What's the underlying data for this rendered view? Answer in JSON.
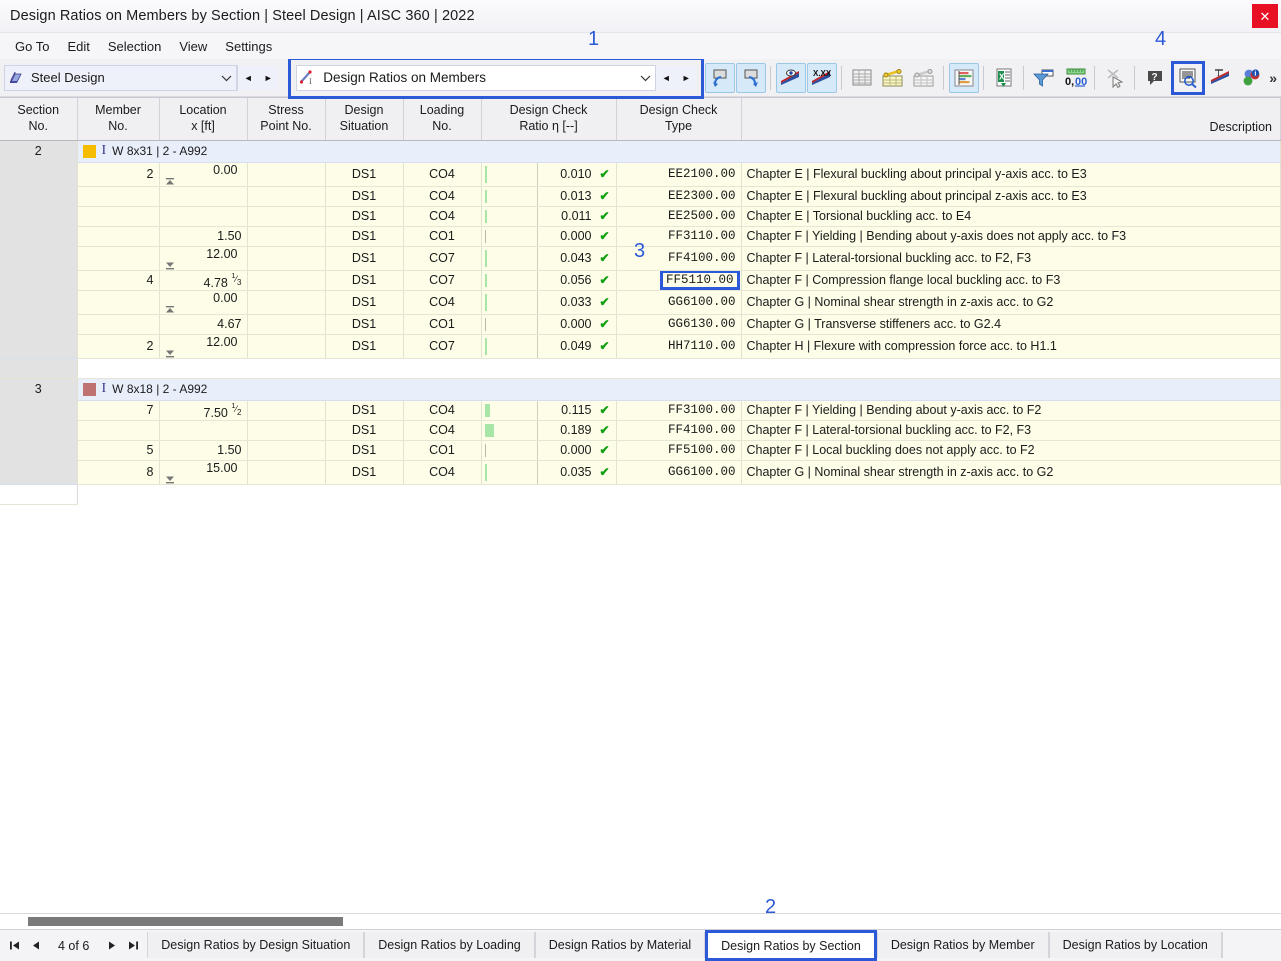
{
  "window": {
    "title": "Design Ratios on Members by Section | Steel Design | AISC 360 | 2022",
    "close_label": "✕"
  },
  "menu": {
    "items": [
      {
        "label": "Go To",
        "name": "menu-go-to"
      },
      {
        "label": "Edit",
        "name": "menu-edit"
      },
      {
        "label": "Selection",
        "name": "menu-selection"
      },
      {
        "label": "View",
        "name": "menu-view"
      },
      {
        "label": "Settings",
        "name": "menu-settings"
      }
    ]
  },
  "toolbar": {
    "module_combo": {
      "value": "Steel Design",
      "icon": "steel-beam-icon"
    },
    "table_combo": {
      "value": "Design Ratios on Members",
      "icon": "design-ratio-icon"
    },
    "caret": "⌵",
    "prev": "◄",
    "next": "►",
    "overflow": "»",
    "buttons": [
      {
        "name": "undo-view-button",
        "icon": "undo-screen-icon"
      },
      {
        "name": "redo-view-button",
        "icon": "redo-screen-icon"
      },
      {
        "name": "show-results-button",
        "icon": "eye-results-icon"
      },
      {
        "name": "show-values-button",
        "icon": "xxx-values-icon"
      },
      {
        "name": "table-all-button",
        "icon": "table-grey-icon"
      },
      {
        "name": "table-members-button",
        "icon": "table-member-icon"
      },
      {
        "name": "table-surfaces-button",
        "icon": "table-surface-icon"
      },
      {
        "name": "result-diagram-button",
        "icon": "bar-diagram-icon"
      },
      {
        "name": "export-excel-button",
        "icon": "excel-export-icon"
      },
      {
        "name": "filter-button",
        "icon": "funnel-icon"
      },
      {
        "name": "decimal-places-button",
        "icon": "decimals-0-00-icon"
      },
      {
        "name": "select-objects-button",
        "icon": "arrow-select-icon"
      },
      {
        "name": "help-button",
        "icon": "question-balloon-icon"
      },
      {
        "name": "table-report-button",
        "icon": "table-magnifier-icon"
      },
      {
        "name": "member-results-button",
        "icon": "member-diagram-icon"
      },
      {
        "name": "info-button",
        "icon": "color-info-icon"
      }
    ]
  },
  "callouts": [
    {
      "number": "1",
      "name": "callout-1"
    },
    {
      "number": "2",
      "name": "callout-2"
    },
    {
      "number": "3",
      "name": "callout-3"
    },
    {
      "number": "4",
      "name": "callout-4"
    }
  ],
  "table": {
    "columns": [
      {
        "label_1": "Section",
        "label_2": "No."
      },
      {
        "label_1": "Member",
        "label_2": "No."
      },
      {
        "label_1": "Location",
        "label_2": "x [ft]"
      },
      {
        "label_1": "Stress",
        "label_2": "Point No."
      },
      {
        "label_1": "Design",
        "label_2": "Situation"
      },
      {
        "label_1": "Loading",
        "label_2": "No."
      },
      {
        "label_1": "Design Check",
        "label_2": "Ratio η [--]"
      },
      {
        "label_1": "Design Check",
        "label_2": "Type"
      },
      {
        "label_1": "",
        "label_2": "Description"
      }
    ],
    "groups": [
      {
        "section_no": "2",
        "color": "#f5bc00",
        "title": "W 8x31 | 2 - A992",
        "rows": [
          {
            "member": "2",
            "location": "0.00",
            "loc_mark": "start",
            "stress_point": "",
            "design_situation": "DS1",
            "loading": "CO4",
            "ratio": "0.010",
            "bar_pct": 1.0,
            "check_type": "EE2100.00",
            "description": "Chapter E | Flexural buckling about principal y-axis acc. to E3",
            "highlight": false
          },
          {
            "member": "",
            "location": "",
            "loc_mark": "",
            "stress_point": "",
            "design_situation": "DS1",
            "loading": "CO4",
            "ratio": "0.013",
            "bar_pct": 1.3,
            "check_type": "EE2300.00",
            "description": "Chapter E | Flexural buckling about principal z-axis acc. to E3",
            "highlight": false
          },
          {
            "member": "",
            "location": "",
            "loc_mark": "",
            "stress_point": "",
            "design_situation": "DS1",
            "loading": "CO4",
            "ratio": "0.011",
            "bar_pct": 1.1,
            "check_type": "EE2500.00",
            "description": "Chapter E | Torsional buckling acc. to E4",
            "highlight": false
          },
          {
            "member": "",
            "location": "1.50",
            "loc_mark": "",
            "stress_point": "",
            "design_situation": "DS1",
            "loading": "CO1",
            "ratio": "0.000",
            "bar_pct": 0.0,
            "check_type": "FF3110.00",
            "description": "Chapter F | Yielding | Bending about y-axis does not apply acc. to F3",
            "highlight": false
          },
          {
            "member": "",
            "location": "12.00",
            "loc_mark": "end",
            "stress_point": "",
            "design_situation": "DS1",
            "loading": "CO7",
            "ratio": "0.043",
            "bar_pct": 4.3,
            "check_type": "FF4100.00",
            "description": "Chapter F | Lateral-torsional buckling acc. to F2, F3",
            "highlight": false
          },
          {
            "member": "4",
            "location": "4.78",
            "loc_mark": "",
            "loc_frac": "1/3",
            "stress_point": "",
            "design_situation": "DS1",
            "loading": "CO7",
            "ratio": "0.056",
            "bar_pct": 5.6,
            "check_type": "FF5110.00",
            "description": "Chapter F | Compression flange local buckling acc. to F3",
            "highlight": true
          },
          {
            "member": "",
            "location": "0.00",
            "loc_mark": "start",
            "stress_point": "",
            "design_situation": "DS1",
            "loading": "CO4",
            "ratio": "0.033",
            "bar_pct": 3.3,
            "check_type": "GG6100.00",
            "description": "Chapter G | Nominal shear strength in z-axis acc. to G2",
            "highlight": false
          },
          {
            "member": "",
            "location": "4.67",
            "loc_mark": "",
            "stress_point": "",
            "design_situation": "DS1",
            "loading": "CO1",
            "ratio": "0.000",
            "bar_pct": 0.0,
            "check_type": "GG6130.00",
            "description": "Chapter G | Transverse stiffeners acc. to G2.4",
            "highlight": false
          },
          {
            "member": "2",
            "location": "12.00",
            "loc_mark": "end",
            "stress_point": "",
            "design_situation": "DS1",
            "loading": "CO7",
            "ratio": "0.049",
            "bar_pct": 4.9,
            "check_type": "HH7110.00",
            "description": "Chapter H | Flexure with compression force acc. to H1.1",
            "highlight": false
          }
        ]
      },
      {
        "section_no": "3",
        "color": "#bf7272",
        "title": "W 8x18 | 2 - A992",
        "rows": [
          {
            "member": "7",
            "location": "7.50",
            "loc_mark": "",
            "loc_frac": "1/2",
            "stress_point": "",
            "design_situation": "DS1",
            "loading": "CO4",
            "ratio": "0.115",
            "bar_pct": 11.5,
            "check_type": "FF3100.00",
            "description": "Chapter F | Yielding | Bending about y-axis acc. to F2",
            "highlight": false
          },
          {
            "member": "",
            "location": "",
            "loc_mark": "",
            "stress_point": "",
            "design_situation": "DS1",
            "loading": "CO4",
            "ratio": "0.189",
            "bar_pct": 18.9,
            "check_type": "FF4100.00",
            "description": "Chapter F | Lateral-torsional buckling acc. to F2, F3",
            "highlight": false
          },
          {
            "member": "5",
            "location": "1.50",
            "loc_mark": "",
            "stress_point": "",
            "design_situation": "DS1",
            "loading": "CO1",
            "ratio": "0.000",
            "bar_pct": 0.0,
            "check_type": "FF5100.00",
            "description": "Chapter F | Local buckling does not apply acc. to F2",
            "highlight": false
          },
          {
            "member": "8",
            "location": "15.00",
            "loc_mark": "end",
            "stress_point": "",
            "design_situation": "DS1",
            "loading": "CO4",
            "ratio": "0.035",
            "bar_pct": 3.5,
            "check_type": "GG6100.00",
            "description": "Chapter G | Nominal shear strength in z-axis acc. to G2",
            "highlight": false
          }
        ]
      }
    ],
    "ok_mark": "✔"
  },
  "status": {
    "page_label": "4 of 6",
    "first": "⏮",
    "prev": "◀",
    "next": "▶",
    "last": "⏭",
    "tabs": [
      {
        "label": "Design Ratios by Design Situation",
        "selected": false
      },
      {
        "label": "Design Ratios by Loading",
        "selected": false
      },
      {
        "label": "Design Ratios by Material",
        "selected": false
      },
      {
        "label": "Design Ratios by Section",
        "selected": true
      },
      {
        "label": "Design Ratios by Member",
        "selected": false
      },
      {
        "label": "Design Ratios by Location",
        "selected": false
      }
    ]
  },
  "colors": {
    "accent_highlight": "#2b59d8",
    "row_background": "#fdfde8",
    "group_background": "#e8eefa",
    "ok_green": "#11a011",
    "bar_green": "#a8e6a8"
  }
}
